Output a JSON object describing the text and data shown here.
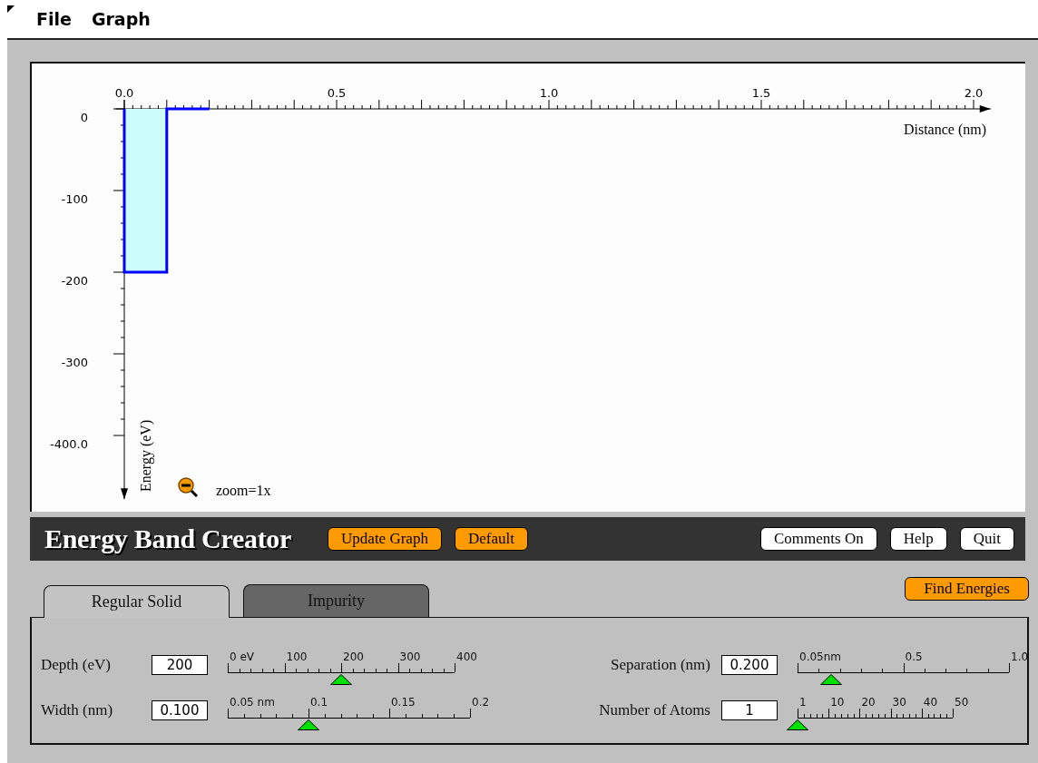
{
  "menu": [
    {
      "label": "File"
    },
    {
      "label": "Graph"
    }
  ],
  "graph": {
    "zoom_label": "zoom=1x",
    "chart_data": {
      "type": "line",
      "xlabel": "Distance (nm)",
      "ylabel": "Energy (eV)",
      "x": [
        0,
        0,
        0.1,
        0.1,
        0.2
      ],
      "series": [
        {
          "color": "#0000ff",
          "values": [
            0,
            -200,
            -200,
            0,
            0
          ]
        }
      ],
      "xticks": [
        {
          "value": 0,
          "label": "0.0"
        },
        {
          "value": 0.5,
          "label": "0.5"
        },
        {
          "value": 1,
          "label": "1.0"
        },
        {
          "value": 1.5,
          "label": "1.5"
        },
        {
          "value": 2,
          "label": "2.0"
        }
      ],
      "yticks": [
        0,
        -100,
        -200,
        -300,
        {
          "value": -400,
          "label": "-400.0"
        }
      ],
      "xlim": [
        -0.02,
        2.04
      ],
      "ylim": [
        -478,
        11
      ]
    }
  },
  "toolbar": {
    "title": "Energy Band Creator",
    "left_buttons": [
      {
        "label": "Update Graph"
      },
      {
        "label": "Default"
      }
    ],
    "right_buttons": [
      {
        "label": "Comments On"
      },
      {
        "label": "Help"
      },
      {
        "label": "Quit"
      }
    ]
  },
  "tabs": [
    {
      "label": "Regular Solid",
      "selected": true
    },
    {
      "label": "Impurity",
      "selected": false
    }
  ],
  "find_button": {
    "label": "Find Energies"
  },
  "left_controls": [
    {
      "label": "Depth (eV)",
      "value": "200",
      "scale": [
        "0 eV",
        "100",
        "200",
        "300",
        "400"
      ],
      "level": 0.5
    },
    {
      "label": "Width (nm)",
      "value": "0.100",
      "scale": [
        "0.05 nm",
        "0.1",
        "0.15",
        "0.2"
      ],
      "level": 0.333
    }
  ],
  "right_controls": [
    {
      "label": "Separation (nm)",
      "value": "0.200",
      "scale": [
        "0.05nm",
        "0.5",
        "1.0"
      ],
      "level": 0.158
    },
    {
      "label": "Number of Atoms",
      "value": "1",
      "scale": [
        "1",
        "10",
        "20",
        "30",
        "40",
        "50"
      ],
      "level": 0
    }
  ]
}
